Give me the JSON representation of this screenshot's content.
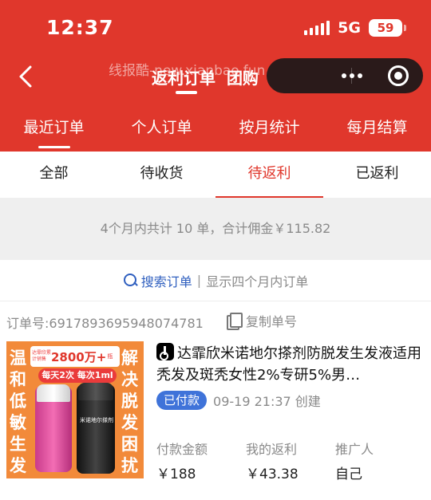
{
  "status_bar": {
    "time": "12:37",
    "network": "5G",
    "battery": "59"
  },
  "nav": {
    "title_part1": "返利订单",
    "title_part2": "团购",
    "watermark": "线报酷-new.xianbao.fun"
  },
  "main_tabs": [
    {
      "label": "最近订单"
    },
    {
      "label": "个人订单"
    },
    {
      "label": "按月统计"
    },
    {
      "label": "每月结算"
    }
  ],
  "sub_tabs": [
    {
      "label": "全部"
    },
    {
      "label": "待收货"
    },
    {
      "label": "待返利"
    },
    {
      "label": "已返利"
    }
  ],
  "summary": {
    "text": "4个月内共计 10 单，合计佣金￥115.82"
  },
  "search": {
    "link_label": "搜索订单",
    "separator": "|",
    "hint": "显示四个月内订单"
  },
  "order": {
    "order_id": "订单号:6917893695948074781",
    "copy_label": "复制单号",
    "title": "达霏欣米诺地尔搽剂防脱发生发液适用秃发及斑秃女性2%专研5%男…",
    "status_badge": "已付款",
    "time_text": "09-19 21:37 创建",
    "stats": [
      {
        "label": "付款金额",
        "value": "￥188"
      },
      {
        "label": "我的返利",
        "value": "￥43.38"
      },
      {
        "label": "推广人",
        "value": "自己"
      }
    ],
    "image": {
      "left_text": "温和低敏生发",
      "right_text": "解决脱发困扰",
      "badge_small": "达霏欣累计销售",
      "badge_big": "2800万+",
      "badge_unit": "瓶",
      "pill": "每天2次 每次1ml",
      "bottle_label": "米诺地尔搽剂"
    }
  },
  "colors": {
    "brand_red": "#e0372c",
    "link_blue": "#2f5fbf",
    "badge_blue": "#3f73d9"
  },
  "icons": [
    "back-icon",
    "more-dots-icon",
    "target-icon",
    "search-icon",
    "copy-icon",
    "tiktok-icon"
  ]
}
